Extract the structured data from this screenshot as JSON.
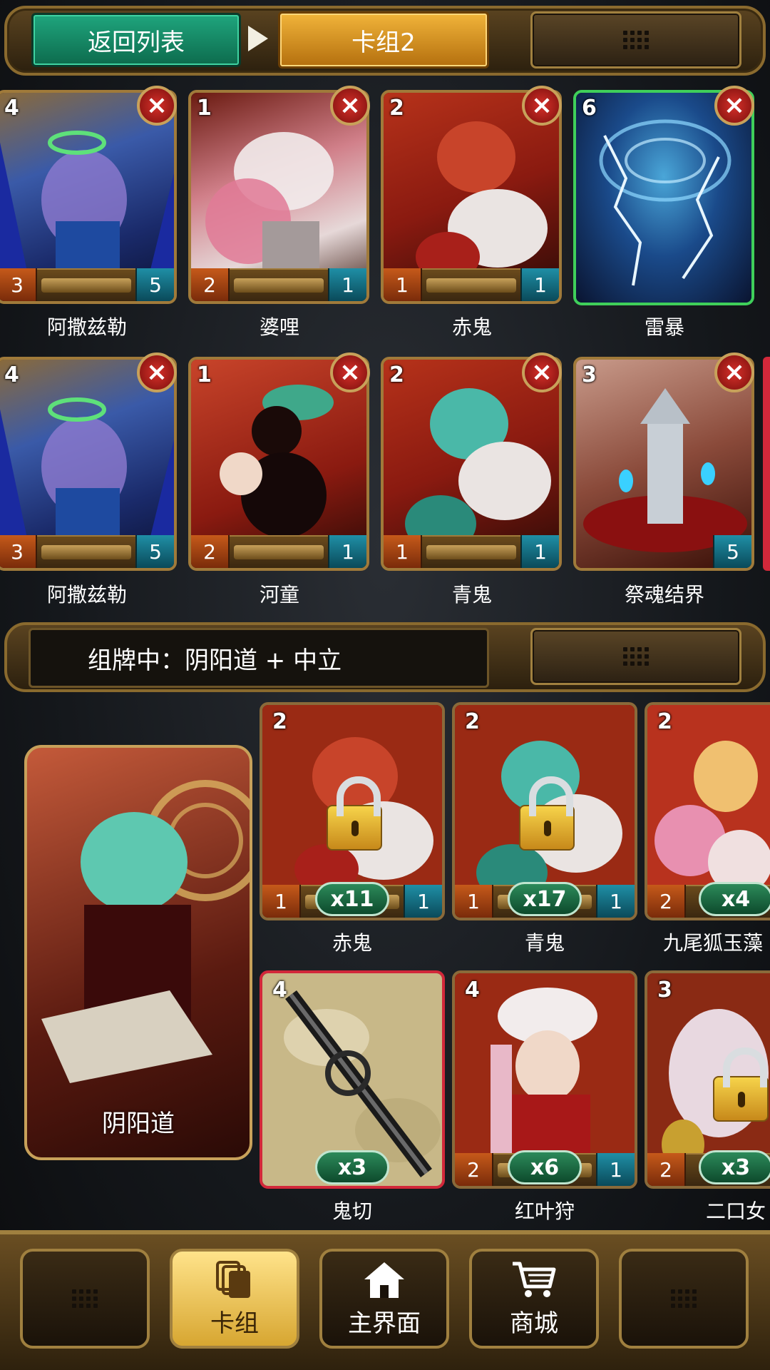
{
  "top_bar": {
    "back_label": "返回列表",
    "deck_name": "卡组2"
  },
  "deck_cards": [
    {
      "name": "阿撒兹勒",
      "cost": "4",
      "atk": "3",
      "hp": "5"
    },
    {
      "name": "婆哩",
      "cost": "1",
      "atk": "2",
      "hp": "1"
    },
    {
      "name": "赤鬼",
      "cost": "2",
      "atk": "1",
      "hp": "1"
    },
    {
      "name": "雷暴",
      "cost": "6",
      "atk": "",
      "hp": ""
    },
    {
      "name": "阿撒兹勒",
      "cost": "4",
      "atk": "3",
      "hp": "5"
    },
    {
      "name": "河童",
      "cost": "1",
      "atk": "2",
      "hp": "1"
    },
    {
      "name": "青鬼",
      "cost": "2",
      "atk": "1",
      "hp": "1"
    },
    {
      "name": "祭魂结界",
      "cost": "3",
      "atk": "",
      "hp": "5"
    }
  ],
  "remove_symbol": "×",
  "filter": {
    "text": "组牌中：阴阳道 + 中立"
  },
  "class_panel": {
    "label": "阴阳道"
  },
  "collection_cards": [
    {
      "name": "赤鬼",
      "cost": "2",
      "atk": "1",
      "hp": "1",
      "count": "x11",
      "locked": true
    },
    {
      "name": "青鬼",
      "cost": "2",
      "atk": "1",
      "hp": "1",
      "count": "x17",
      "locked": true
    },
    {
      "name": "九尾狐玉藻",
      "cost": "2",
      "atk": "2",
      "hp": "",
      "count": "x4",
      "locked": false
    },
    {
      "name": "鬼切",
      "cost": "4",
      "atk": "",
      "hp": "",
      "count": "x3",
      "locked": false
    },
    {
      "name": "红叶狩",
      "cost": "4",
      "atk": "2",
      "hp": "1",
      "count": "x6",
      "locked": false
    },
    {
      "name": "二口女",
      "cost": "3",
      "atk": "2",
      "hp": "",
      "count": "x3",
      "locked": true
    }
  ],
  "bottom_nav": {
    "deck_label": "卡组",
    "home_label": "主界面",
    "shop_label": "商城"
  },
  "colors": {
    "back_button": "#1fa57d",
    "deck_tab": "#f1b43a",
    "remove_badge": "#d6302a",
    "count_pill": "#2c8a5a",
    "nav_active": "#ffe38a"
  }
}
